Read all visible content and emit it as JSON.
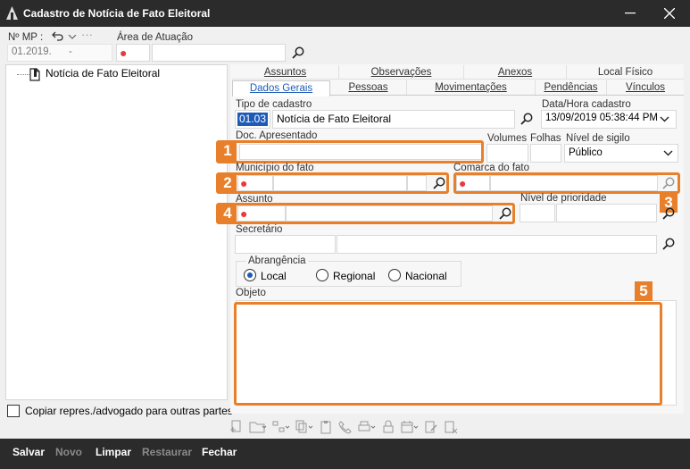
{
  "window": {
    "title": "Cadastro de Notícia de Fato Eleitoral",
    "minimize": "—",
    "close": "✕"
  },
  "header": {
    "nmp_label": "Nº MP :",
    "nmp_value": "01.2019.",
    "nmp_dash": "-",
    "area_label": "Área de Atuação"
  },
  "tree": {
    "root_label": "Notícia de Fato Eleitoral"
  },
  "tabs": {
    "row1": [
      "Assuntos",
      "Observações",
      "Anexos",
      "Local Físico"
    ],
    "row2": [
      "Dados Gerais",
      "Pessoas",
      "Movimentações",
      "Pendências",
      "Vínculos"
    ]
  },
  "form": {
    "tipo_cadastro_label": "Tipo de cadastro",
    "tipo_code": "01.03",
    "tipo_value": "Notícia de Fato Eleitoral",
    "data_hora_label": "Data/Hora cadastro",
    "data_hora_value": "13/09/2019 05:38:44 PM",
    "doc_label": "Doc. Apresentado",
    "volumes_label": "Volumes",
    "folhas_label": "Folhas",
    "sigilo_label": "Nível de sigilo",
    "sigilo_value": "Público",
    "municipio_label": "Município do fato",
    "comarca_label": "Comarca do fato",
    "assunto_label": "Assunto",
    "prioridade_label": "Nível de prioridade",
    "secretario_label": "Secretário",
    "abrangencia_label": "Abrangência",
    "abrangencia_options": [
      "Local",
      "Regional",
      "Nacional"
    ],
    "abrangencia_selected": "Local",
    "objeto_label": "Objeto"
  },
  "callouts": [
    "1",
    "2",
    "3",
    "4",
    "5"
  ],
  "copy_checkbox_label": "Copiar repres./advogado para outras partes",
  "bottom": {
    "salvar": "Salvar",
    "novo": "Novo",
    "limpar": "Limpar",
    "restaurar": "Restaurar",
    "fechar": "Fechar"
  },
  "accent_orange": "#e8802b",
  "required_dot": "●"
}
